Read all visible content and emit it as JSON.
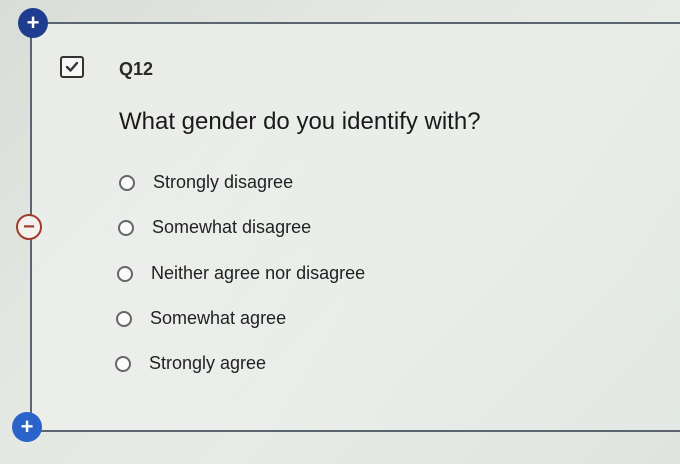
{
  "question": {
    "number": "Q12",
    "text": "What gender do you identify with?",
    "choices": [
      "Strongly disagree",
      "Somewhat disagree",
      "Neither agree nor disagree",
      "Somewhat agree",
      "Strongly agree"
    ]
  },
  "icons": {
    "add_top": "+",
    "add_bottom": "+",
    "remove": "−"
  },
  "colors": {
    "add_top": "#1f3c8f",
    "add_bottom": "#2a63c9",
    "remove_border": "#a23a2c"
  }
}
